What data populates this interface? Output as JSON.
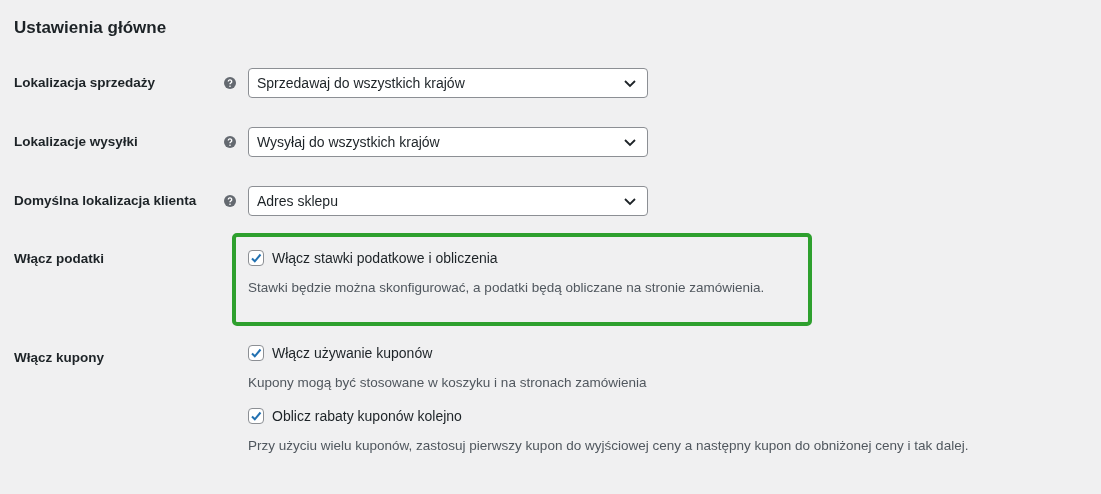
{
  "title": "Ustawienia główne",
  "selects": [
    {
      "label": "Lokalizacja sprzedaży",
      "value": "Sprzedawaj do wszystkich krajów"
    },
    {
      "label": "Lokalizacje wysyłki",
      "value": "Wysyłaj do wszystkich krajów"
    },
    {
      "label": "Domyślna lokalizacja klienta",
      "value": "Adres sklepu"
    }
  ],
  "groups": [
    {
      "label": "Włącz podatki",
      "highlighted": true,
      "options": [
        {
          "label": "Włącz stawki podatkowe i obliczenia",
          "checked": true,
          "description": "Stawki będzie można skonfigurować, a podatki będą obliczane na stronie zamówienia."
        }
      ]
    },
    {
      "label": "Włącz kupony",
      "highlighted": false,
      "options": [
        {
          "label": "Włącz używanie kuponów",
          "checked": true,
          "description": "Kupony mogą być stosowane w koszyku i na stronach zamówienia"
        },
        {
          "label": "Oblicz rabaty kuponów kolejno",
          "checked": true,
          "description": "Przy użyciu wielu kuponów, zastosuj pierwszy kupon do wyjściowej ceny a następny kupon do obniżonej ceny i tak dalej."
        }
      ]
    }
  ]
}
